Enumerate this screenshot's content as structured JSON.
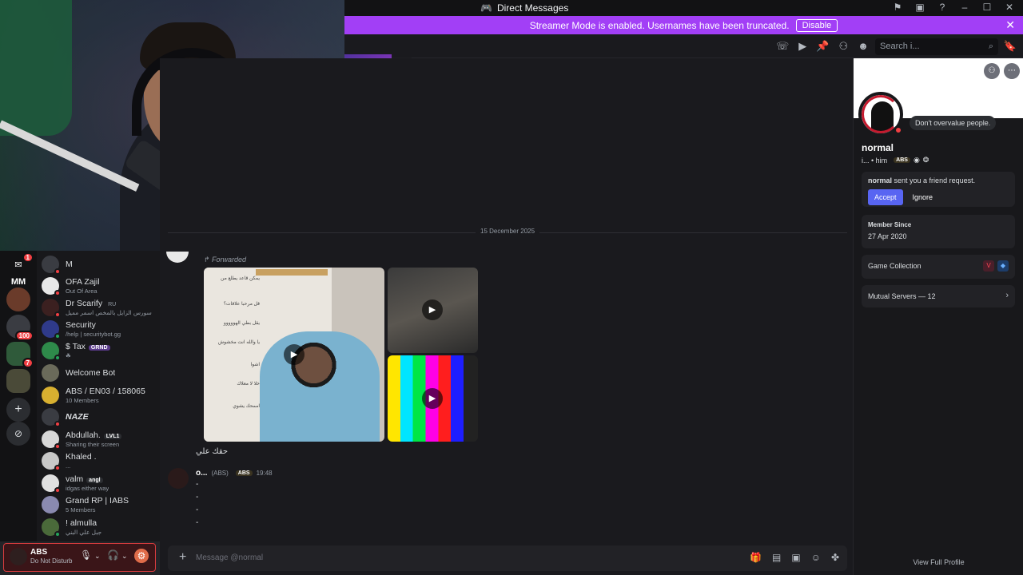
{
  "window": {
    "title": "Direct Messages"
  },
  "banner": {
    "text": "Streamer Mode is enabled. Usernames have been truncated.",
    "disable_label": "Disable"
  },
  "header": {
    "search_placeholder": "Search i..."
  },
  "rail": {
    "dm_badge": "1",
    "mm_label": "MM",
    "badges": [
      "100",
      "7"
    ]
  },
  "dm_list": [
    {
      "name": "M",
      "sub": ""
    },
    {
      "name": "OFA Zajil",
      "sub": "Out Of Area"
    },
    {
      "name": "Dr Scarify",
      "tag": "RU",
      "sub": "سورس الزايل بالمخص اسمر مميل"
    },
    {
      "name": "Security",
      "sub": "/help | securitybot.gg"
    },
    {
      "name": "$ Tax",
      "tag": "GRND",
      "sub": "☘"
    },
    {
      "name": "Welcome Bot",
      "sub": ""
    },
    {
      "name": "ABS / EN03 / 158065",
      "sub": "10 Members"
    },
    {
      "name": "NAZE",
      "sub": ""
    },
    {
      "name": "Abdullah.",
      "tag": "LVL1",
      "sub": "Sharing their screen"
    },
    {
      "name": "Khaled .",
      "sub": "..."
    },
    {
      "name": "valm",
      "tag": "angl",
      "sub": "idgas either way"
    },
    {
      "name": "Grand RP | IABS",
      "sub": "5 Members"
    },
    {
      "name": "! almulla",
      "sub": "جبل علي البني"
    }
  ],
  "user_panel": {
    "name": "ABS",
    "status": "Do Not Disturb"
  },
  "chat": {
    "date_divider": "15 December 2025",
    "forwarded_label": "Forwarded",
    "caption": "حقك علي",
    "media_notes": [
      "يمكن قاعد يطلع من",
      "قل مرحبا علاقات؟",
      "يقل بطي الهووووو",
      "يا والله انت مخشوش",
      "اشوا",
      "خلا لا معلاك",
      "اممحك يشوي"
    ],
    "message": {
      "author": "o...",
      "role": "(ABS)",
      "tag": "ABS",
      "time": "19:48",
      "lines": [
        "-",
        "-",
        "-",
        "-"
      ]
    }
  },
  "composer": {
    "placeholder": "Message @normal"
  },
  "profile": {
    "status_bubble": "Don't overvalue people.",
    "name": "normal",
    "pronouns": "i... • him",
    "tag": "ABS",
    "friend_request_user": "normal",
    "friend_request_text": "sent you a friend request.",
    "accept_label": "Accept",
    "ignore_label": "Ignore",
    "member_since_label": "Member Since",
    "member_since_value": "27 Apr 2020",
    "game_collection_label": "Game Collection",
    "mutual_servers_label": "Mutual Servers — 12",
    "view_full_label": "View Full Profile"
  },
  "colors": {
    "streamer_banner": "#a23ff6",
    "accept_button": "#5865f2",
    "dnd_status": "#f23f43",
    "online_status": "#23a55a"
  }
}
